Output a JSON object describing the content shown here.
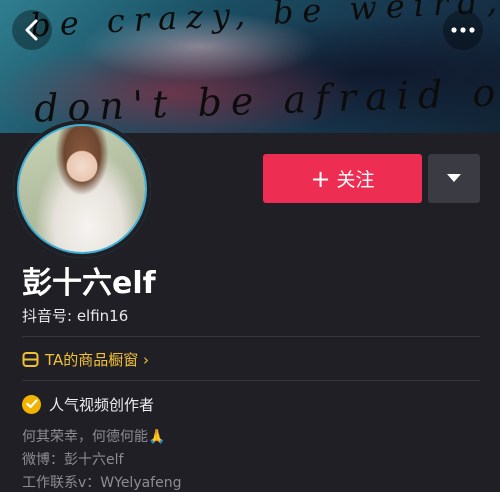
{
  "cover": {
    "line1": "be crazy, be weird,",
    "line2": "don't be afraid of"
  },
  "header": {
    "back_icon": "chevron-left-icon",
    "more_icon": "more-dots-icon"
  },
  "profile": {
    "name": "彭十六elf",
    "douyin_id": "抖音号: elfin16",
    "follow_label": "关注",
    "follow_plus": "+",
    "shop_link": "TA的商品橱窗 ›",
    "creator_badge": "人气视频创作者",
    "bio": [
      "何其荣幸，何德何能🙏",
      "微博：彭十六elf",
      "工作联系v：WYelyafeng"
    ]
  },
  "colors": {
    "follow_button": "#ee2d53",
    "avatar_ring": "#3fb0d6",
    "shop_link": "#f1c034",
    "badge": "#f1b300",
    "background": "#1f1f25"
  }
}
